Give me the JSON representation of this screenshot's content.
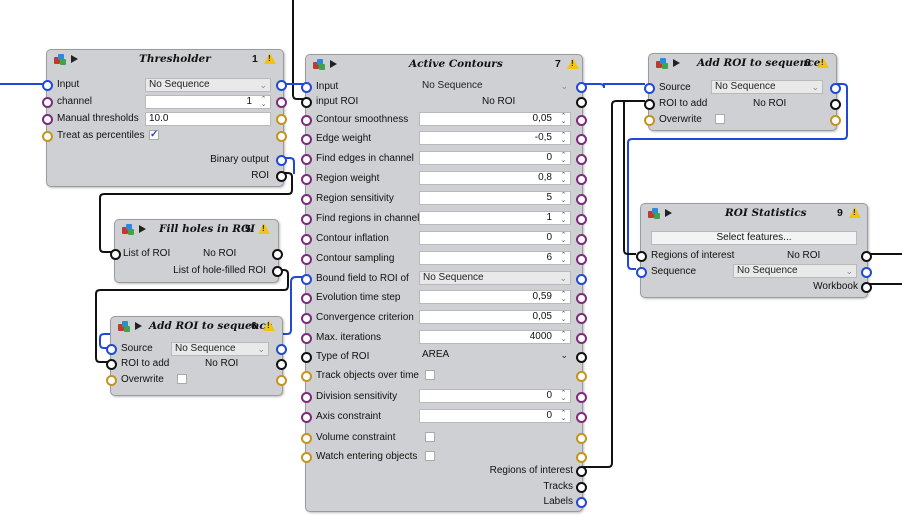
{
  "nodes": {
    "thresholder": {
      "title": "Thresholder",
      "id": "1",
      "input_label": "Input",
      "input_value": "No Sequence",
      "channel_label": "channel",
      "channel_value": "1",
      "manual_label": "Manual thresholds",
      "manual_value": "10.0",
      "percent_label": "Treat as percentiles",
      "percent_checked": "✓",
      "out_binary": "Binary output",
      "out_roi": "ROI"
    },
    "fill_holes": {
      "title": "Fill holes in ROI",
      "id": "5",
      "list_label": "List of ROI",
      "list_value": "No ROI",
      "out_filled": "List of hole-filled ROI"
    },
    "add_roi_6": {
      "title": "Add ROI to sequence",
      "id": "6",
      "source_label": "Source",
      "source_value": "No Sequence",
      "roi_label": "ROI to add",
      "roi_value": "No ROI",
      "overwrite_label": "Overwrite"
    },
    "active_contours": {
      "title": "Active Contours",
      "id": "7",
      "rows": [
        {
          "label": "Input",
          "value": "No Sequence"
        },
        {
          "label": "input ROI",
          "value": "No ROI"
        },
        {
          "label": "Contour smoothness",
          "value": "0,05"
        },
        {
          "label": "Edge weight",
          "value": "-0,5"
        },
        {
          "label": "Find edges in channel",
          "value": "0"
        },
        {
          "label": "Region weight",
          "value": "0,8"
        },
        {
          "label": "Region sensitivity",
          "value": "5"
        },
        {
          "label": "Find regions in channel",
          "value": "1"
        },
        {
          "label": "Contour inflation",
          "value": "0"
        },
        {
          "label": "Contour sampling",
          "value": "6"
        },
        {
          "label": "Bound field to ROI of",
          "value": "No Sequence"
        },
        {
          "label": "Evolution time step",
          "value": "0,59"
        },
        {
          "label": "Convergence criterion",
          "value": "0,05"
        },
        {
          "label": "Max. iterations",
          "value": "4000"
        },
        {
          "label": "Type of ROI",
          "value": "AREA"
        },
        {
          "label": "Track objects over time",
          "value": ""
        },
        {
          "label": "Division sensitivity",
          "value": "0"
        },
        {
          "label": "Axis constraint",
          "value": "0"
        },
        {
          "label": "Volume constraint",
          "value": ""
        },
        {
          "label": "Watch entering objects",
          "value": ""
        }
      ],
      "outputs": [
        "Regions of interest",
        "Tracks",
        "Labels"
      ]
    },
    "add_roi_8": {
      "title": "Add ROI to sequence",
      "id": "8",
      "source_label": "Source",
      "source_value": "No Sequence",
      "roi_label": "ROI to add",
      "roi_value": "No ROI",
      "overwrite_label": "Overwrite"
    },
    "roi_stats": {
      "title": "ROI Statistics",
      "id": "9",
      "button_label": "Select features...",
      "regions_label": "Regions of interest",
      "regions_value": "No ROI",
      "sequence_label": "Sequence",
      "sequence_value": "No Sequence",
      "out_workbook": "Workbook"
    }
  },
  "colors": {
    "node_bg": "#cfd0d3",
    "sequence_port": "#2149d6",
    "roi_port": "#111111",
    "int_port": "#7d2a7d",
    "bool_port": "#c4941e",
    "warning": "#f1c40f"
  }
}
